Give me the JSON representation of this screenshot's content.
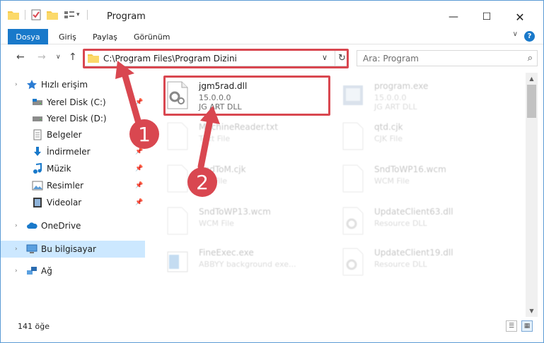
{
  "window": {
    "title": "Program"
  },
  "ribbon": {
    "file": "Dosya",
    "tabs": [
      "Giriş",
      "Paylaş",
      "Görünüm"
    ],
    "help": "?"
  },
  "address": {
    "path": "C:\\Program Files\\Program Dizini",
    "search_placeholder": "Ara: Program"
  },
  "nav": {
    "quick_access": "Hızlı erişim",
    "items": [
      "Yerel Disk (C:)",
      "Yerel Disk (D:)",
      "Belgeler",
      "İndirmeler",
      "Müzik",
      "Resimler",
      "Videolar"
    ],
    "onedrive": "OneDrive",
    "this_pc": "Bu bilgisayar",
    "network": "Ağ"
  },
  "files": [
    {
      "name": "jgm5rad.dll",
      "meta1": "15.0.0.0",
      "meta2": "JG ART DLL"
    },
    {
      "name": "program.exe",
      "meta1": "15.0.0.0",
      "meta2": "JG ART DLL"
    },
    {
      "name": "MachineReader.txt",
      "meta1": "Text File",
      "meta2": ""
    },
    {
      "name": "qtd.cjk",
      "meta1": "CJK File",
      "meta2": ""
    },
    {
      "name": "SndToM.cjk",
      "meta1": "CJK File",
      "meta2": ""
    },
    {
      "name": "SndToWP16.wcm",
      "meta1": "WCM File",
      "meta2": ""
    },
    {
      "name": "SndToWP13.wcm",
      "meta1": "WCM File",
      "meta2": ""
    },
    {
      "name": "UpdateClient63.dll",
      "meta1": "Resource DLL",
      "meta2": ""
    },
    {
      "name": "FineExec.exe",
      "meta1": "ABBYY background exe...",
      "meta2": ""
    },
    {
      "name": "UpdateClient19.dll",
      "meta1": "Resource DLL",
      "meta2": ""
    }
  ],
  "status": {
    "count": "141 öğe"
  },
  "annotations": {
    "step1": "1",
    "step2": "2"
  },
  "colors": {
    "accent": "#1979ca",
    "highlight": "#d94750",
    "selected": "#cce8ff"
  }
}
